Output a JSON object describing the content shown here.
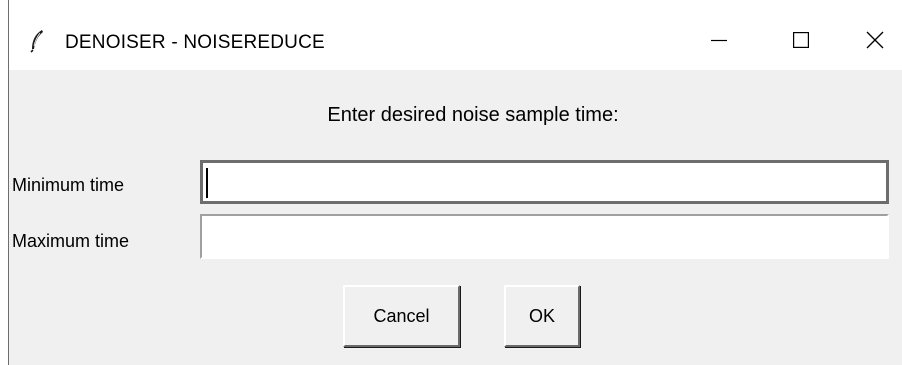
{
  "window": {
    "title": "DENOISER - NOISEREDUCE",
    "controls": {
      "minimize_icon": "minimize-icon",
      "maximize_icon": "maximize-icon",
      "close_icon": "close-icon"
    },
    "app_icon": "feather-icon"
  },
  "dialog": {
    "prompt": "Enter desired noise sample time:",
    "fields": [
      {
        "label": "Minimum time",
        "value": "",
        "focused": true
      },
      {
        "label": "Maximum time",
        "value": "",
        "focused": false
      }
    ],
    "buttons": {
      "cancel_label": "Cancel",
      "ok_label": "OK"
    }
  },
  "colors": {
    "window_bg": "#f0f0f0",
    "titlebar_bg": "#ffffff",
    "focused_border": "#6d6d6d"
  }
}
